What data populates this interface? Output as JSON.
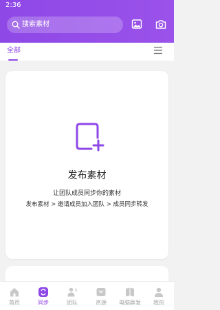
{
  "status_bar": {
    "time": "2:36"
  },
  "header": {
    "search_placeholder": "搜索素材",
    "icons": [
      "image-icon",
      "camera-icon"
    ]
  },
  "tabs": {
    "all": "全部"
  },
  "card": {
    "title": "发布素材",
    "description": "让团队成员同步你的素材",
    "steps": "发布素材 > 邀请成员加入团队 > 成员同步转发"
  },
  "bottom_nav": {
    "items": [
      {
        "label": "首页",
        "icon": "home-icon",
        "active": false
      },
      {
        "label": "同步",
        "icon": "sync-icon",
        "active": true
      },
      {
        "label": "团队",
        "icon": "team-icon",
        "active": false
      },
      {
        "label": "资源",
        "icon": "resource-icon",
        "active": false
      },
      {
        "label": "电脑群发",
        "icon": "computer-icon",
        "active": false
      },
      {
        "label": "我的",
        "icon": "profile-icon",
        "active": false
      }
    ]
  },
  "colors": {
    "accent": "#8e48e6",
    "icon_gradient_start": "#f3b33d",
    "icon_gradient_end": "#8e48e6",
    "inactive": "#a3a3a3"
  }
}
